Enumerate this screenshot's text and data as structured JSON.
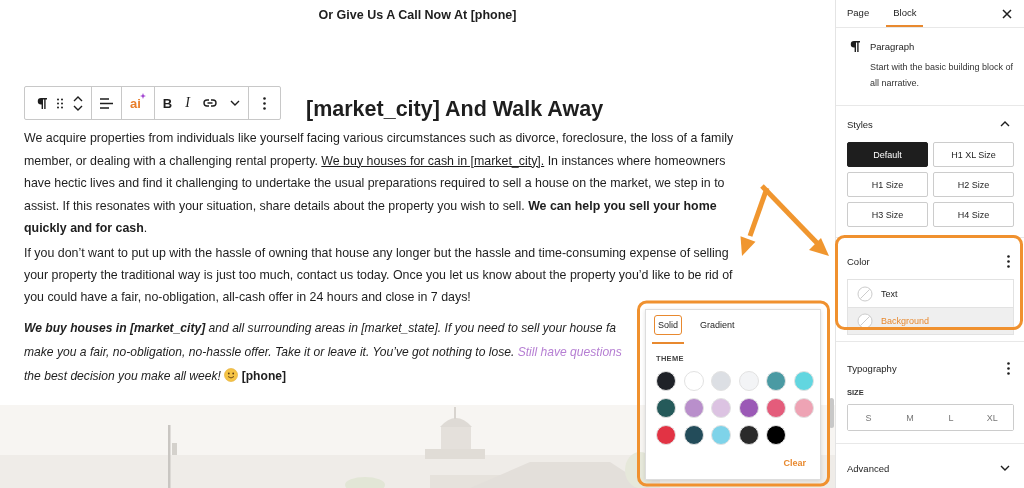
{
  "page_header": {
    "text": "Or Give Us A Call Now At [phone]"
  },
  "block_toolbar": {
    "ai_label": "ai",
    "bold_label": "B",
    "italic_label": "I"
  },
  "heading": {
    "text": "[market_city] And Walk Away"
  },
  "paragraphs": [
    {
      "kind": "plain",
      "lines": [
        [
          {
            "kind": "text",
            "text": "We acquire properties from individuals like yourself facing various circumstances such as divorce, foreclosure, the loss of a family"
          }
        ],
        [
          {
            "kind": "text",
            "text": "member, or dealing with a challenging rental property. "
          },
          {
            "kind": "link",
            "text": "We buy houses for cash in [market_city]."
          },
          {
            "kind": "text",
            "text": " In instances where homeowners"
          }
        ],
        [
          {
            "kind": "text",
            "text": "have hectic lives and find it challenging to undertake the usual preparations required to sell a house on the market, we step in to"
          }
        ],
        [
          {
            "kind": "text",
            "text": "assist. If this resonates with your situation, share details about the property you wish to sell. **We can help you sell your home**"
          }
        ],
        [
          {
            "kind": "text",
            "text": "**quickly and for cash**."
          }
        ]
      ]
    },
    {
      "kind": "plain",
      "lines": [
        [
          {
            "kind": "text",
            "text": "If you don’t want to put up with the hassle of owning that house any longer but the hassle and time-consuming expense of selling"
          }
        ],
        [
          {
            "kind": "text",
            "text": "your property the traditional way is just too much, contact us today. Once you let us know about the property you’d like to be rid of"
          }
        ],
        [
          {
            "kind": "text",
            "text": "you could have a fair, no-obligation, all-cash offer in 24 hours and close in 7 days!"
          }
        ]
      ]
    },
    {
      "kind": "emphasis",
      "lines": [
        [
          {
            "kind": "text",
            "text": "**We buy houses in [market_city]** and all surrounding areas in [market_state]. If you need to sell your house fa"
          }
        ],
        [
          {
            "kind": "text",
            "text": "make you a fair, no-obligation, no-hassle offer. Take it or leave it. You’ve got nothing to lose. "
          },
          {
            "kind": "accent_link",
            "text": "Still have questions"
          }
        ],
        [
          {
            "kind": "text",
            "text": "the best decision you make all week! "
          },
          {
            "kind": "smiley"
          },
          {
            "kind": "strong",
            "text": " [phone]"
          }
        ]
      ]
    }
  ],
  "color_popover": {
    "tabs": [
      {
        "label": "Solid",
        "selected": true
      },
      {
        "label": "Gradient",
        "selected": false
      }
    ],
    "section_label": "THEME",
    "swatches": [
      {
        "color": "#1f2228"
      },
      {
        "color": "#ffffff"
      },
      {
        "color": "#dcdfe4"
      },
      {
        "color": "#f3f4f6"
      },
      {
        "color": "#4a9aa3"
      },
      {
        "color": "#62d6e0"
      },
      {
        "color": "#255a5a"
      },
      {
        "color": "#b98fcb"
      },
      {
        "color": "#dcc3e2"
      },
      {
        "color": "#9b59b6"
      },
      {
        "color": "#e45c7b"
      },
      {
        "color": "#eea3b4"
      },
      {
        "color": "#e23344"
      },
      {
        "color": "#234c5a"
      },
      {
        "color": "#7ed3e9"
      },
      {
        "color": "#2a2a2a"
      },
      {
        "color": "#000000"
      }
    ],
    "clear_label": "Clear"
  },
  "sidebar": {
    "tabs": [
      {
        "label": "Page",
        "selected": false
      },
      {
        "label": "Block",
        "selected": true
      }
    ],
    "block": {
      "title": "Paragraph",
      "description": "Start with the basic building block of all narrative."
    },
    "styles": {
      "title": "Styles",
      "expanded": true,
      "options": [
        {
          "label": "Default",
          "selected": true
        },
        {
          "label": "H1 XL Size",
          "selected": false
        },
        {
          "label": "H1 Size",
          "selected": false
        },
        {
          "label": "H2 Size",
          "selected": false
        },
        {
          "label": "H3 Size",
          "selected": false
        },
        {
          "label": "H4 Size",
          "selected": false
        }
      ]
    },
    "color": {
      "title": "Color",
      "items": [
        {
          "label": "Text",
          "selected": false
        },
        {
          "label": "Background",
          "selected": true
        }
      ]
    },
    "typography": {
      "title": "Typography",
      "size_label": "SIZE",
      "sizes": [
        {
          "label": "S",
          "selected": false
        },
        {
          "label": "M",
          "selected": false
        },
        {
          "label": "L",
          "selected": false
        },
        {
          "label": "XL",
          "selected": false
        }
      ]
    },
    "advanced": {
      "title": "Advanced",
      "expanded": false
    }
  }
}
